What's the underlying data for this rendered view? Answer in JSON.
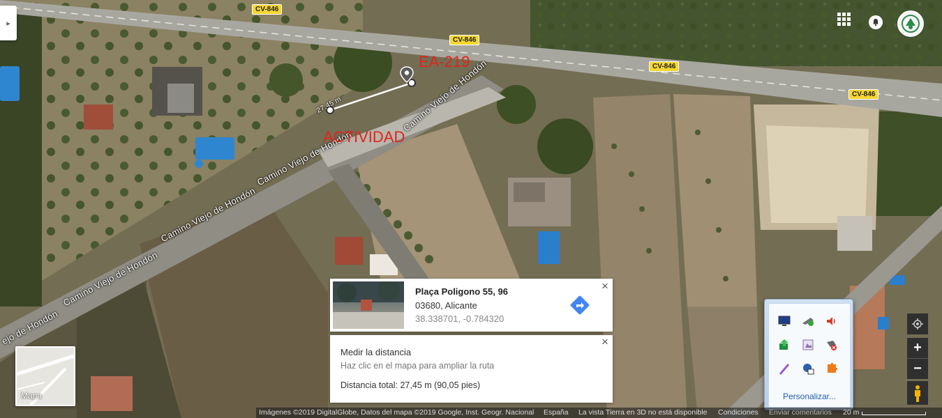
{
  "map": {
    "roads": {
      "camino_labels": [
        "Camino Viejo de Hondón",
        "Camino Viejo de Hondón",
        "Camino Viejo de Hondón",
        "Camino Viejo de Hondón",
        "Camino Viejo de Hondón",
        "ejo de Hondón"
      ],
      "shields": [
        "CV-846",
        "CV-846",
        "CV-846",
        "CV-846"
      ]
    },
    "annotations": {
      "ea_label": "EA-219",
      "actividad_label": "ACTIVIDAD",
      "measure_line_label": "27,45 m"
    }
  },
  "header": {
    "apps_icon": "apps-grid-icon",
    "notifications_icon": "bell-icon",
    "avatar_icon": "account-avatar"
  },
  "side_panel_toggle": {
    "icon": "chevron-right-icon",
    "glyph": "▸"
  },
  "place_card": {
    "title": "Plaça Poligono 55, 96",
    "address": "03680, Alicante",
    "coordinates": "38.338701, -0.784320",
    "directions_icon": "directions-arrow-icon",
    "close_glyph": "×"
  },
  "measure_card": {
    "title": "Medir la distancia",
    "hint": "Haz clic en el mapa para ampliar la ruta",
    "total": "Distancia total: 27,45 m (90,05 pies)",
    "close_glyph": "×"
  },
  "system_tray": {
    "icons": [
      "monitor-icon",
      "network-icon",
      "speaker-icon",
      "update-icon",
      "photo-icon",
      "security-icon",
      "pen-icon",
      "language-icon",
      "puzzle-icon"
    ],
    "customize_link": "Personalizar..."
  },
  "map_controls": {
    "location_icon": "my-location-icon",
    "zoom_in": "+",
    "zoom_out": "−",
    "pegman_icon": "pegman-icon"
  },
  "minimap": {
    "label": "Mapa"
  },
  "footer": {
    "attribution": "Imágenes ©2019 DigitalGlobe, Datos del mapa ©2019 Google, Inst. Geogr. Nacional",
    "country": "España",
    "notice": "La vista Tierra en 3D no está disponible",
    "terms": "Condiciones",
    "feedback": "Enviar comentarios",
    "scale": "20 m"
  },
  "colors": {
    "annotation_red": "#e0241b",
    "shield_yellow": "#f5d631",
    "directions_blue": "#4285f4"
  }
}
